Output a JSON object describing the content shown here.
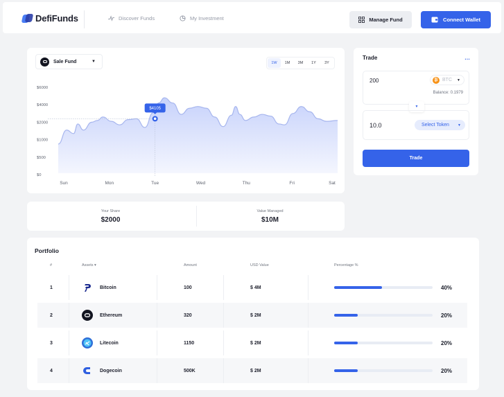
{
  "app": {
    "brand": "DefiFunds",
    "nav": [
      {
        "label": "Discover Funds"
      },
      {
        "label": "My Investment"
      }
    ],
    "manage_fund_label": "Manage Fund",
    "connect_wallet_label": "Connect Wallet"
  },
  "chart_panel": {
    "fund_selected": "Sale Fund",
    "ranges": [
      "1W",
      "1M",
      "3M",
      "1Y",
      "3Y"
    ],
    "active_range": "1W",
    "tooltip": "$4105"
  },
  "chart_data": {
    "type": "area",
    "categories": [
      "Sun",
      "Mon",
      "Tue",
      "Wed",
      "Thu",
      "Fri",
      "Sat"
    ],
    "ytick_labels": [
      "$6000",
      "$4000",
      "$2000",
      "$1000",
      "$500",
      "$0"
    ],
    "series": [
      {
        "x_pos": [
          0,
          0.03,
          0.055,
          0.07,
          0.09,
          0.12,
          0.14,
          0.16,
          0.19,
          0.22,
          0.25,
          0.28,
          0.31,
          0.34,
          0.36,
          0.38,
          0.41,
          0.44,
          0.47,
          0.5,
          0.53,
          0.56,
          0.59,
          0.62,
          0.635,
          0.65,
          0.67,
          0.7,
          0.73,
          0.76,
          0.79,
          0.81,
          0.84,
          0.87,
          0.9,
          0.93,
          0.96,
          1.0
        ],
        "values_level": [
          1.75,
          2.55,
          2.35,
          2.9,
          2.55,
          3.0,
          3.1,
          3.3,
          3.05,
          2.85,
          3.15,
          3.2,
          2.7,
          3.55,
          4.105,
          4.4,
          4.1,
          3.45,
          3.8,
          3.9,
          3.8,
          3.3,
          2.75,
          3.4,
          3.9,
          3.45,
          3.1,
          3.3,
          3.45,
          3.35,
          2.9,
          2.85,
          3.5,
          3.9,
          3.6,
          3.2,
          3.05,
          3.1
        ]
      }
    ],
    "highlight": {
      "category": "Tue",
      "value": 4105
    },
    "grid": false
  },
  "stats": {
    "your_share_label": "Your Share",
    "your_share_value": "$2000",
    "value_managed_label": "Value Managed",
    "value_managed_value": "$10M"
  },
  "trade": {
    "title": "Trade",
    "more_label": "…",
    "from_amount": "200",
    "from_token": "BTC",
    "balance": "Balance: 0.1979",
    "to_amount": "10.0",
    "select_token_label": "Select Token",
    "button_label": "Trade"
  },
  "portfolio": {
    "title": "Portfolio",
    "headers": {
      "num": "#",
      "assets": "Assets ▾",
      "amount": "Amount",
      "usd": "USD Value",
      "pct": "Percentage %"
    },
    "rows": [
      {
        "n": "1",
        "asset": "Bitcoin",
        "amount": "100",
        "usd": "$ 4M",
        "pct": "40%",
        "fraction": 0.4,
        "icon": "bitcoin-icon"
      },
      {
        "n": "2",
        "asset": "Ethereum",
        "amount": "320",
        "usd": "$ 2M",
        "pct": "20%",
        "fraction": 0.2,
        "icon": "ethereum-icon"
      },
      {
        "n": "3",
        "asset": "Litecoin",
        "amount": "1150",
        "usd": "$ 2M",
        "pct": "20%",
        "fraction": 0.2,
        "icon": "litecoin-icon"
      },
      {
        "n": "4",
        "asset": "Dogecoin",
        "amount": "500K",
        "usd": "$ 2M",
        "pct": "20%",
        "fraction": 0.2,
        "icon": "dogecoin-icon"
      }
    ]
  },
  "colors": {
    "accent": "#3563e9",
    "chart_line": "#a7b6ee",
    "chart_fill_top": "#c7d2fb",
    "chart_fill_bottom": "#f4f6fe"
  }
}
